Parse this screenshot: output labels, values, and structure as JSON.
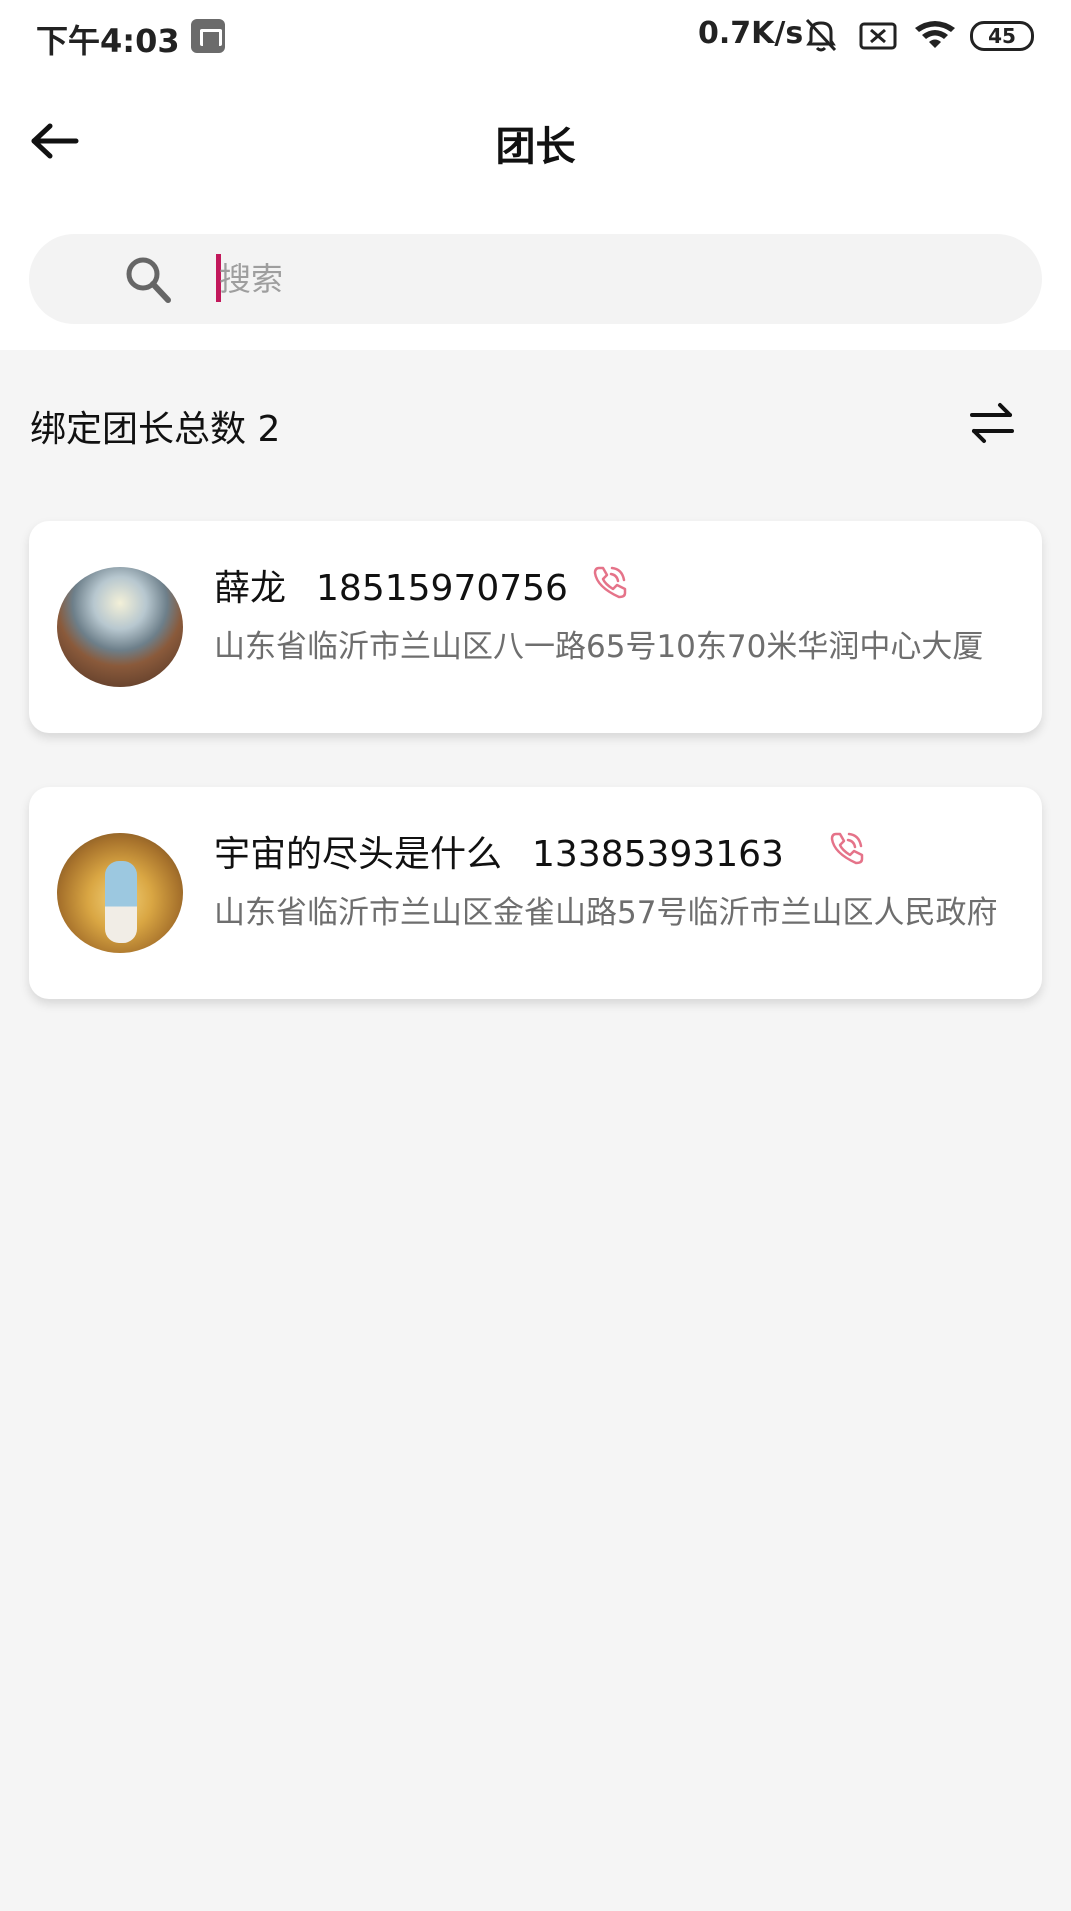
{
  "status_bar": {
    "time": "下午4:03",
    "net_speed": "0.7K/s",
    "battery": "45"
  },
  "header": {
    "title": "团长"
  },
  "search": {
    "placeholder": "搜索",
    "value": ""
  },
  "summary": {
    "count_label": "绑定团长总数 2"
  },
  "leaders": [
    {
      "name": "薛龙",
      "phone": "18515970756",
      "address": "山东省临沂市兰山区八一路65号10东70米华润中心大厦"
    },
    {
      "name": "宇宙的尽头是什么",
      "phone": "13385393163",
      "address": "山东省临沂市兰山区金雀山路57号临沂市兰山区人民政府"
    }
  ],
  "colors": {
    "accent": "#c2185b",
    "phone_icon": "#e57389"
  }
}
